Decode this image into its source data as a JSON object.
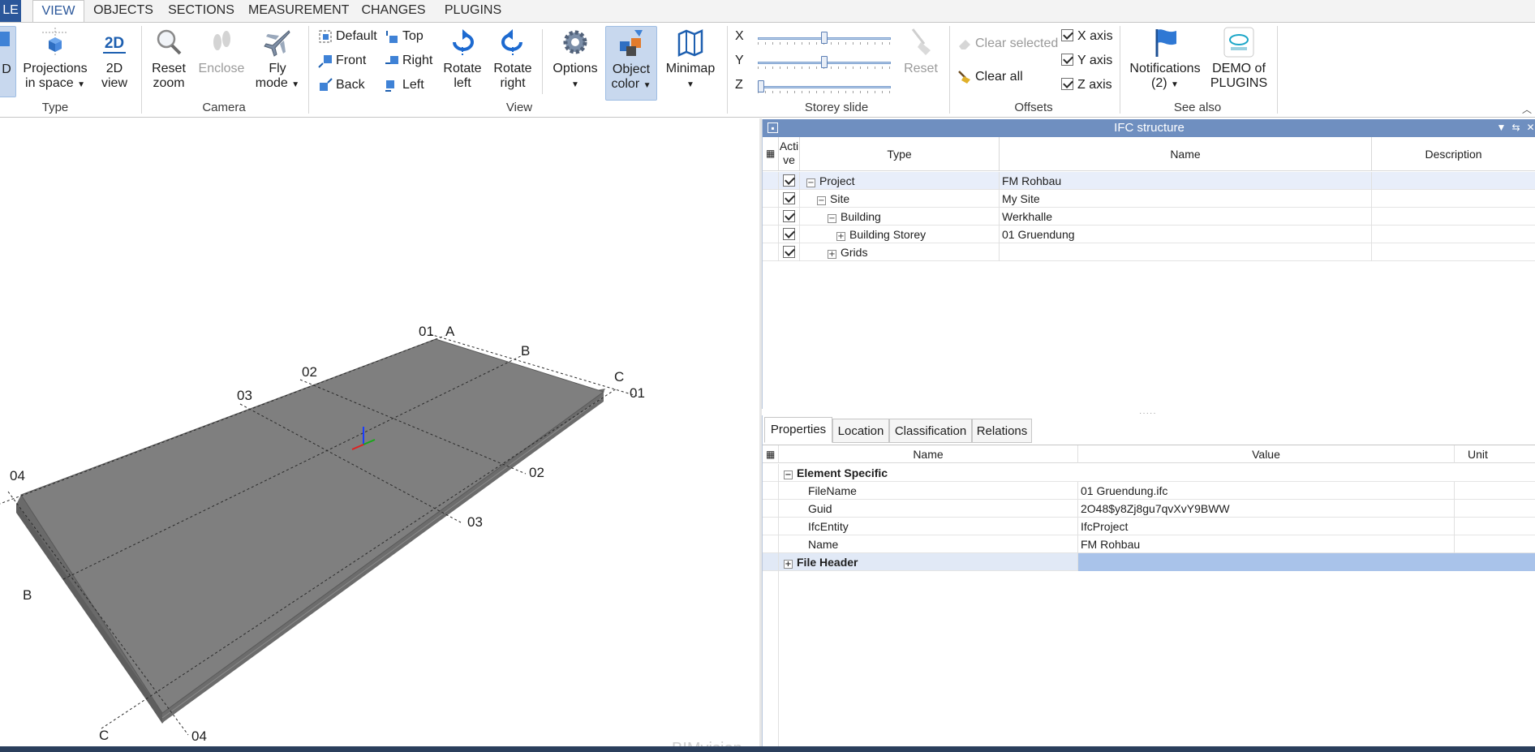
{
  "tabs": {
    "file": "LE",
    "items": [
      "VIEW",
      "OBJECTS",
      "SECTIONS",
      "MEASUREMENT",
      "CHANGES",
      "PLUGINS"
    ],
    "active": "VIEW"
  },
  "ribbon": {
    "type_group": {
      "label": "Type",
      "partial_btn": "D",
      "projections": {
        "line1": "Projections",
        "line2": "in space"
      },
      "view2d": {
        "line1": "2D",
        "line2": "view",
        "icon_text": "2D"
      }
    },
    "camera_group": {
      "label": "Camera",
      "reset_zoom": {
        "line1": "Reset",
        "line2": "zoom"
      },
      "enclose": "Enclose",
      "fly_mode": {
        "line1": "Fly",
        "line2": "mode"
      }
    },
    "view_group": {
      "label": "View",
      "default": "Default",
      "top": "Top",
      "front": "Front",
      "right": "Right",
      "back": "Back",
      "left": "Left",
      "rotate_left": {
        "line1": "Rotate",
        "line2": "left"
      },
      "rotate_right": {
        "line1": "Rotate",
        "line2": "right"
      },
      "options": "Options",
      "object_color": {
        "line1": "Object",
        "line2": "color"
      },
      "minimap": "Minimap"
    },
    "storey_group": {
      "label": "Storey slide",
      "x_label": "X",
      "y_label": "Y",
      "z_label": "Z",
      "x_value": 0.5,
      "y_value": 0.5,
      "z_value": 0.0,
      "reset": "Reset"
    },
    "offsets_group": {
      "label": "Offsets",
      "clear_selected": "Clear selected",
      "clear_all": "Clear all",
      "x_axis": "X axis",
      "y_axis": "Y axis",
      "z_axis": "Z axis",
      "x_checked": true,
      "y_checked": true,
      "z_checked": true
    },
    "see_also_group": {
      "label": "See also",
      "notifications": {
        "line1": "Notifications",
        "line2": "(2)"
      },
      "demo": {
        "line1": "DEMO of",
        "line2": "PLUGINS"
      }
    }
  },
  "viewport": {
    "grid_labels": {
      "a_top": "A",
      "one_top": "01",
      "b_top": "B",
      "c_top": "C",
      "one_right": "01",
      "two_top": "02",
      "three_top": "03",
      "two_right": "02",
      "three_right": "03",
      "four_left": "04",
      "b_left": "B",
      "c_bottom": "C",
      "four_bottom": "04"
    },
    "watermark": "BIMvision"
  },
  "ifc_structure": {
    "title": "IFC structure",
    "columns": {
      "active": "Acti ve",
      "type": "Type",
      "name": "Name",
      "description": "Description"
    },
    "rows": [
      {
        "type": "Project",
        "name": "FM Rohbau",
        "expander": "−",
        "checked": true
      },
      {
        "type": "Site",
        "name": "My Site",
        "expander": "−",
        "checked": true
      },
      {
        "type": "Building",
        "name": "Werkhalle",
        "expander": "−",
        "checked": true
      },
      {
        "type": "Building Storey",
        "name": "01 Gruendung",
        "expander": "+",
        "checked": true
      },
      {
        "type": "Grids",
        "name": "",
        "expander": "+",
        "checked": true
      }
    ]
  },
  "properties": {
    "tabs": [
      "Properties",
      "Location",
      "Classification",
      "Relations"
    ],
    "columns": {
      "name": "Name",
      "value": "Value",
      "unit": "Unit"
    },
    "group1": "Element Specific",
    "rows": [
      {
        "name": "FileName",
        "value": "01 Gruendung.ifc"
      },
      {
        "name": "Guid",
        "value": "2O48$y8Zj8gu7qvXvY9BWW"
      },
      {
        "name": "IfcEntity",
        "value": "IfcProject"
      },
      {
        "name": "Name",
        "value": "FM Rohbau"
      }
    ],
    "group2": "File Header"
  },
  "colors": {
    "accent": "#2b579a",
    "panel_title": "#6f8fc0",
    "selection": "#a9c3ea",
    "slab_top": "#7f7f7f",
    "slab_side": "#6a6a6a"
  }
}
